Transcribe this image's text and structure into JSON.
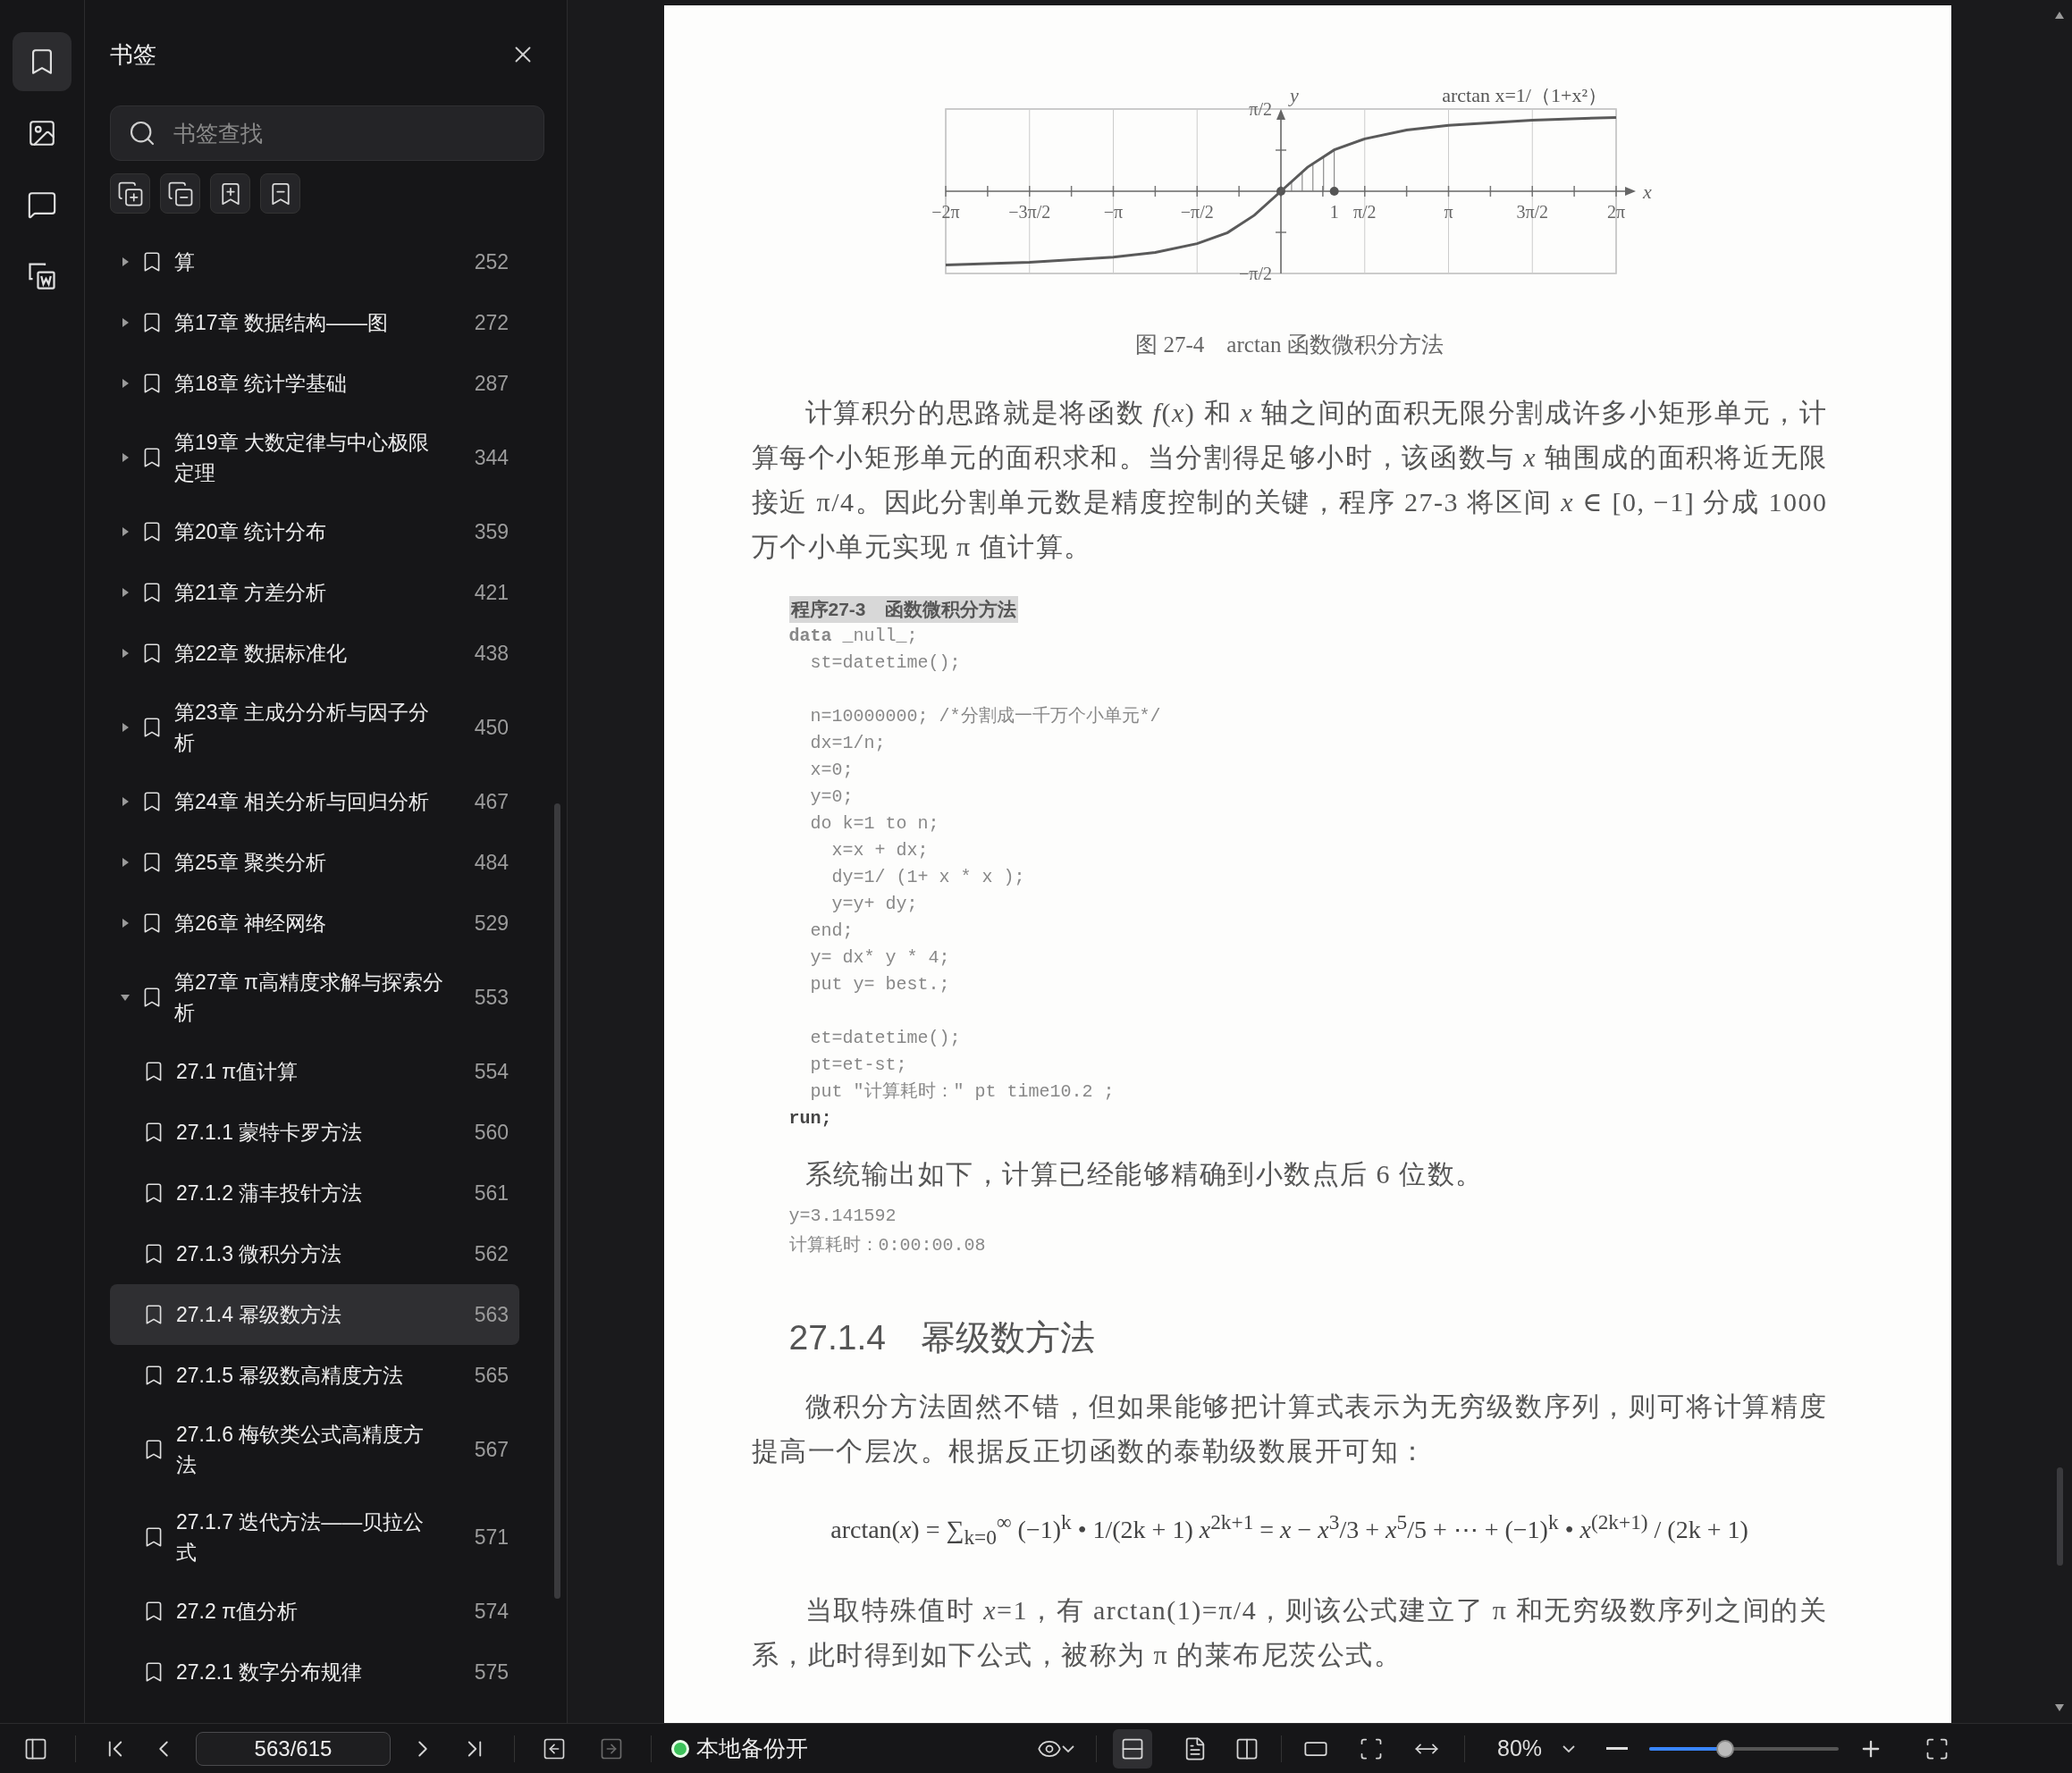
{
  "rail": {
    "items": [
      {
        "kind": "bookmark",
        "selected": true
      },
      {
        "kind": "image",
        "selected": false
      },
      {
        "kind": "comment",
        "selected": false
      },
      {
        "kind": "convert",
        "selected": false
      }
    ]
  },
  "sidebar": {
    "title": "书签",
    "search": {
      "placeholder": "书签查找"
    },
    "bookmarks": [
      {
        "label": "算",
        "page": "252",
        "expanded": false,
        "selected": false
      },
      {
        "label": "第17章 数据结构——图",
        "page": "272",
        "expanded": false,
        "selected": false
      },
      {
        "label": "第18章 统计学基础",
        "page": "287",
        "expanded": false,
        "selected": false
      },
      {
        "label": "第19章 大数定律与中心极限定理",
        "page": "344",
        "expanded": false,
        "selected": false
      },
      {
        "label": "第20章 统计分布",
        "page": "359",
        "expanded": false,
        "selected": false
      },
      {
        "label": "第21章 方差分析",
        "page": "421",
        "expanded": false,
        "selected": false
      },
      {
        "label": "第22章 数据标准化",
        "page": "438",
        "expanded": false,
        "selected": false
      },
      {
        "label": "第23章 主成分分析与因子分析",
        "page": "450",
        "expanded": false,
        "selected": false
      },
      {
        "label": "第24章 相关分析与回归分析",
        "page": "467",
        "expanded": false,
        "selected": false
      },
      {
        "label": "第25章 聚类分析",
        "page": "484",
        "expanded": false,
        "selected": false
      },
      {
        "label": "第26章 神经网络",
        "page": "529",
        "expanded": false,
        "selected": false
      },
      {
        "label": "第27章 π高精度求解与探索分析",
        "page": "553",
        "expanded": true,
        "selected": false,
        "children": [
          {
            "label": "27.1 π值计算",
            "page": "554",
            "selected": false
          },
          {
            "label": "27.1.1 蒙特卡罗方法",
            "page": "560",
            "selected": false
          },
          {
            "label": "27.1.2 蒲丰投针方法",
            "page": "561",
            "selected": false
          },
          {
            "label": "27.1.3 微积分方法",
            "page": "562",
            "selected": false
          },
          {
            "label": "27.1.4 幂级数方法",
            "page": "563",
            "selected": true
          },
          {
            "label": "27.1.5 幂级数高精度方法",
            "page": "565",
            "selected": false
          },
          {
            "label": "27.1.6 梅钦类公式高精度方法",
            "page": "567",
            "selected": false
          },
          {
            "label": "27.1.7 迭代方法——贝拉公式",
            "page": "571",
            "selected": false
          },
          {
            "label": "27.2 π值分析",
            "page": "574",
            "selected": false
          },
          {
            "label": "27.2.1 数字分布规律",
            "page": "575",
            "selected": false
          }
        ]
      }
    ]
  },
  "document": {
    "blocks": [
      {
        "kind": "chart",
        "chart_data": {
          "type": "line",
          "title": "图 27-4　arctan 函数微积分方法",
          "xlabel": "x",
          "ylabel": "y",
          "x": [
            -6.283,
            -4.712,
            -3.142,
            -2.356,
            -1.571,
            -1.0,
            -0.5,
            0,
            0.5,
            1.0,
            1.571,
            2.356,
            3.142,
            4.712,
            6.283
          ],
          "series": [
            {
              "name": "arctan x=1/（1+x²）",
              "color": "#5a5a5a",
              "values": [
                -1.41,
                -1.36,
                -1.26,
                -1.17,
                -1.0,
                -0.79,
                -0.46,
                0,
                0.46,
                0.79,
                1.0,
                1.17,
                1.26,
                1.36,
                1.41
              ]
            }
          ],
          "grid": true,
          "xlim": [
            -6.283,
            6.283
          ],
          "ylim": [
            -1.571,
            1.571
          ],
          "xticks": [
            {
              "value": -6.283,
              "label": "−2π"
            },
            {
              "value": -4.712,
              "label": "−3π/2"
            },
            {
              "value": -3.142,
              "label": "−π"
            },
            {
              "value": -1.571,
              "label": "−π/2"
            },
            {
              "value": 1,
              "label": "1"
            },
            {
              "value": 1.571,
              "label": "π/2"
            },
            {
              "value": 3.142,
              "label": "π"
            },
            {
              "value": 4.712,
              "label": "3π/2"
            },
            {
              "value": 6.283,
              "label": "2π"
            }
          ],
          "yticks": [
            {
              "value": 1.571,
              "label": "π/2"
            },
            {
              "value": -1.571,
              "label": "−π/2"
            }
          ]
        }
      },
      {
        "kind": "paragraph",
        "text": "计算积分的思路就是将函数 *f*(*x*) 和 *x* 轴之间的面积无限分割成许多小矩形单元，计算每个小矩形单元的面积求和。当分割得足够小时，该函数与 *x* 轴围成的面积将近无限接近 π/4。因此分割单元数是精度控制的关键，程序 27-3 将区间 *x* ∈ [0, −1] 分成 1000万个小单元实现 π 值计算。"
      },
      {
        "kind": "code",
        "title": "程序27-3　函数微积分方法",
        "groups": [
          [
            {
              "keyword": "data",
              "text": " _null_;",
              "bold": false
            },
            {
              "text": "  st=datetime();",
              "bold": false
            }
          ],
          [
            {
              "text": "  n=10000000; /*分割成一千万个小单元*/",
              "bold": false
            },
            {
              "text": "  dx=1/n;",
              "bold": false
            },
            {
              "text": "  x=0;",
              "bold": false
            },
            {
              "text": "  y=0;",
              "bold": false
            },
            {
              "text": "  do k=1 to n;",
              "bold": false
            },
            {
              "text": "    x=x + dx;",
              "bold": false
            },
            {
              "text": "    dy=1/ (1+ x * x );",
              "bold": false
            },
            {
              "text": "    y=y+ dy;",
              "bold": false
            },
            {
              "text": "  end;",
              "bold": false
            },
            {
              "text": "  y= dx* y * 4;",
              "bold": false
            },
            {
              "text": "  put y= best.;",
              "bold": false
            }
          ],
          [
            {
              "text": "  et=datetime();",
              "bold": false
            },
            {
              "text": "  pt=et-st;",
              "bold": false
            },
            {
              "text": "  put \"计算耗时：\" pt time10.2 ;",
              "bold": false
            },
            {
              "text": "run;",
              "bold": true
            }
          ]
        ]
      },
      {
        "kind": "paragraph",
        "text": "系统输出如下，计算已经能够精确到小数点后 6 位数。"
      },
      {
        "kind": "output",
        "lines": [
          "y=3.141592",
          "计算耗时：0:00:00.08"
        ]
      },
      {
        "kind": "heading",
        "text": "27.1.4　幂级数方法"
      },
      {
        "kind": "paragraph",
        "text": "微积分方法固然不错，但如果能够把计算式表示为无穷级数序列，则可将计算精度提高一个层次。根据反正切函数的泰勒级数展开可知："
      },
      {
        "kind": "formula",
        "text": "arctan(*x*) = ∑$_{k=0}$$^{∞}$ (−1)$^{k}$ • 1/(2k + 1) *x*$^{2k+1}$ = *x* − *x*$^{3}$/3 + *x*$^{5}$/5 + ⋯ + (−1)$^{k}$ • *x*$^{(2k+1)}$ / (2k + 1)"
      },
      {
        "kind": "paragraph",
        "text": "当取特殊值时 *x*=1，有 arctan(1)=π/4，则该公式建立了 π 和无穷级数序列之间的关系，此时得到如下公式，被称为 π 的莱布尼茨公式。"
      }
    ]
  },
  "toolbar": {
    "page_field": "563/615",
    "history": [
      {
        "kind": "back",
        "disabled": false
      },
      {
        "kind": "forward",
        "disabled": true
      }
    ],
    "backup": {
      "label": "本地备份开",
      "on": true
    },
    "view_modes": [
      {
        "kind": "scroll",
        "selected": true
      },
      {
        "kind": "single",
        "selected": false
      },
      {
        "kind": "double",
        "selected": false
      }
    ],
    "zoom": {
      "value": "80%",
      "level": 0.4
    }
  }
}
